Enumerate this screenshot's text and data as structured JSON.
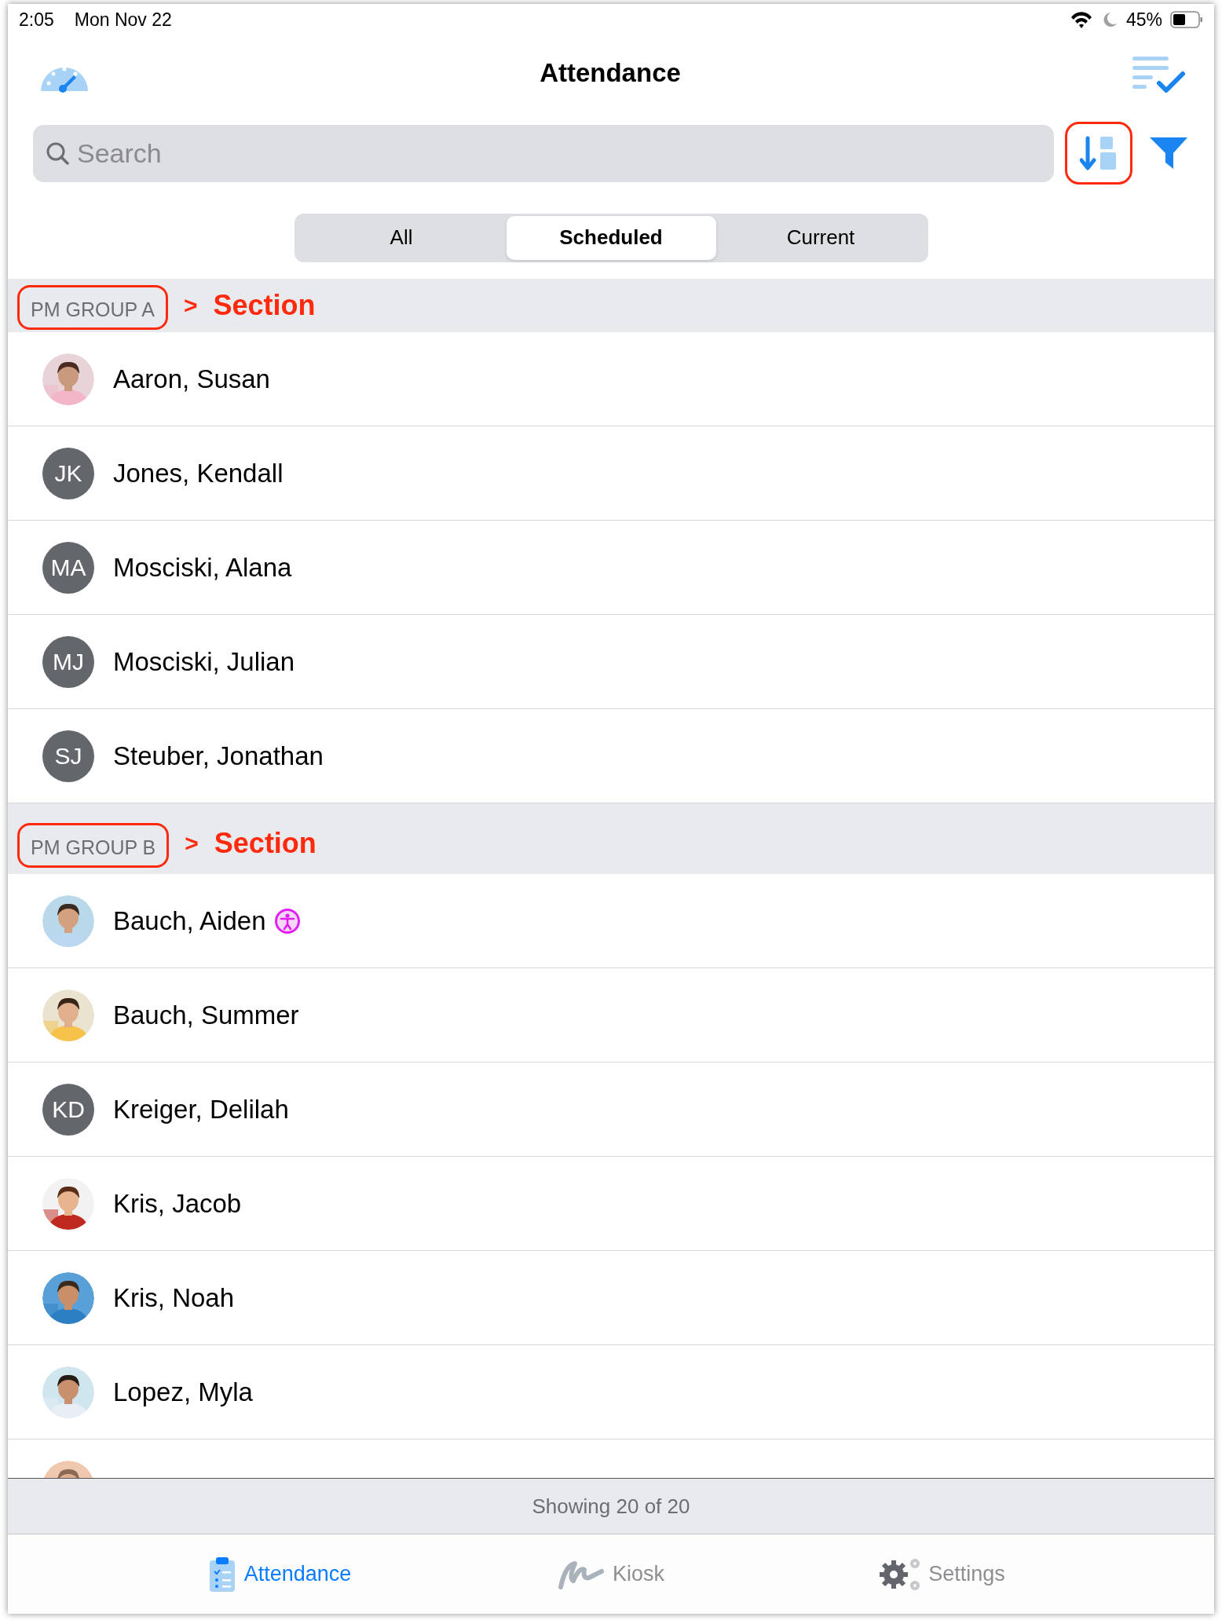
{
  "status_bar": {
    "time": "2:05",
    "date": "Mon Nov 22",
    "battery": "45%"
  },
  "nav": {
    "title": "Attendance"
  },
  "search": {
    "placeholder": "Search"
  },
  "sort_button": {
    "highlighted": true
  },
  "segments": [
    {
      "label": "All",
      "selected": false
    },
    {
      "label": "Scheduled",
      "selected": true
    },
    {
      "label": "Current",
      "selected": false
    }
  ],
  "sections": [
    {
      "title": "PM GROUP A",
      "highlighted": true,
      "annotation_arrow": ">",
      "annotation": "Section",
      "students": [
        {
          "name": "Aaron, Susan",
          "avatar": {
            "kind": "picture"
          }
        },
        {
          "name": "Jones, Kendall",
          "avatar": {
            "kind": "initials",
            "text": "JK"
          }
        },
        {
          "name": "Mosciski, Alana",
          "avatar": {
            "kind": "initials",
            "text": "MA"
          }
        },
        {
          "name": "Mosciski, Julian",
          "avatar": {
            "kind": "initials",
            "text": "MJ"
          }
        },
        {
          "name": "Steuber, Jonathan",
          "avatar": {
            "kind": "initials",
            "text": "SJ"
          }
        }
      ]
    },
    {
      "title": "PM GROUP B",
      "highlighted": true,
      "annotation_arrow": ">",
      "annotation": "Section",
      "students": [
        {
          "name": "Bauch, Aiden",
          "accessibility": true,
          "avatar": {
            "kind": "picture"
          }
        },
        {
          "name": "Bauch, Summer",
          "avatar": {
            "kind": "picture"
          }
        },
        {
          "name": "Kreiger, Delilah",
          "avatar": {
            "kind": "initials",
            "text": "KD"
          }
        },
        {
          "name": "Kris, Jacob",
          "avatar": {
            "kind": "picture"
          }
        },
        {
          "name": "Kris, Noah",
          "avatar": {
            "kind": "picture"
          }
        },
        {
          "name": "Lopez, Myla",
          "avatar": {
            "kind": "picture"
          }
        },
        {
          "avatar": {
            "kind": "picture"
          }
        }
      ]
    }
  ],
  "footer": {
    "text": "Showing 20 of 20"
  },
  "tabs": [
    {
      "label": "Attendance",
      "kind": "clipboard",
      "selected": true
    },
    {
      "label": "Kiosk",
      "kind": "signature",
      "selected": false
    },
    {
      "label": "Settings",
      "kind": "gears",
      "selected": false
    }
  ]
}
